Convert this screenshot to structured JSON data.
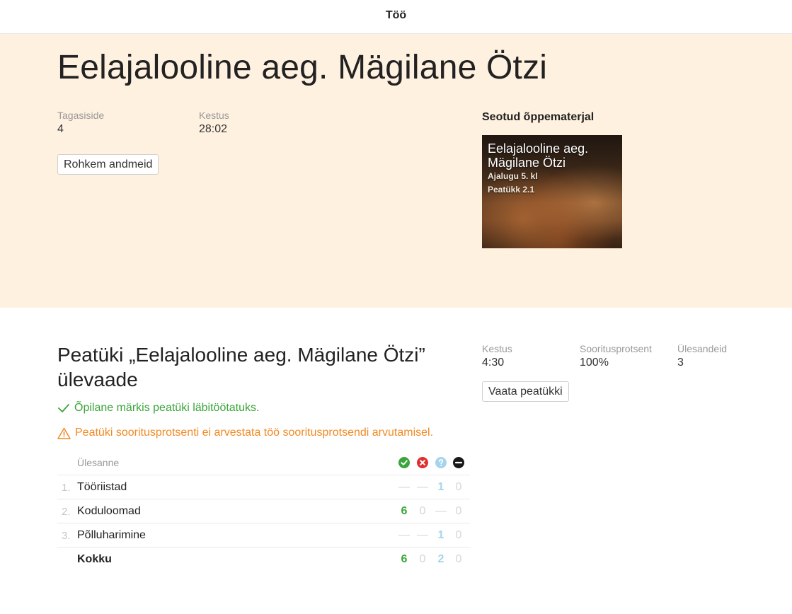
{
  "topbar": {
    "title": "Töö"
  },
  "hero": {
    "title": "Eelajalooline aeg. Mägilane Ötzi",
    "feedback_label": "Tagasiside",
    "feedback_value": "4",
    "duration_label": "Kestus",
    "duration_value": "28:02",
    "more_button": "Rohkem andmeid",
    "related_heading": "Seotud õppematerjal",
    "card": {
      "title": "Eelajalooline aeg. Mägilane Ötzi",
      "subject": "Ajalugu 5. kl",
      "chapter": "Peatükk 2.1"
    }
  },
  "chapter": {
    "title": "Peatüki „Eelajalooline aeg. Mägilane Ötzi” ülevaade",
    "stats": [
      {
        "label": "Kestus",
        "value": "4:30"
      },
      {
        "label": "Sooritusprotsent",
        "value": "100%"
      },
      {
        "label": "Ülesandeid",
        "value": "3"
      }
    ],
    "view_button": "Vaata peatükki",
    "notice_ok": "Õpilane märkis peatüki läbitöötatuks.",
    "notice_warn": "Peatüki sooritusprotsenti ei arvestata töö sooritusprotsendi arvutamisel.",
    "colors": {
      "correct": "#3aa53a",
      "wrong": "#e03030",
      "unknown": "#a6d4ec",
      "skipped": "#1a1a1a",
      "warning": "#f08a24"
    }
  },
  "table": {
    "header": "Ülesanne",
    "rows": [
      {
        "num": "1.",
        "name": "Tööriistad",
        "correct": "—",
        "wrong": "—",
        "unknown": "1",
        "skipped": "0"
      },
      {
        "num": "2.",
        "name": "Koduloomad",
        "correct": "6",
        "wrong": "0",
        "unknown": "—",
        "skipped": "0"
      },
      {
        "num": "3.",
        "name": "Põlluharimine",
        "correct": "—",
        "wrong": "—",
        "unknown": "1",
        "skipped": "0"
      }
    ],
    "total": {
      "name": "Kokku",
      "correct": "6",
      "wrong": "0",
      "unknown": "2",
      "skipped": "0"
    }
  }
}
